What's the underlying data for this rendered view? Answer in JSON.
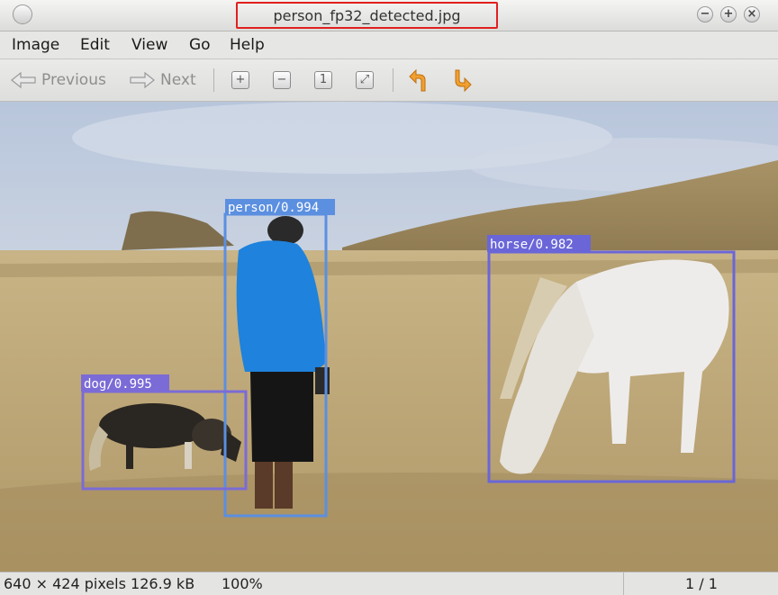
{
  "window": {
    "title": "person_fp32_detected.jpg",
    "buttons": {
      "minimize": "−",
      "maximize": "+",
      "close": "×"
    }
  },
  "menu": [
    "Image",
    "Edit",
    "View",
    "Go",
    "Help"
  ],
  "toolbar": {
    "previous_label": "Previous",
    "next_label": "Next",
    "icons": [
      "zoom-in-icon",
      "zoom-out-icon",
      "zoom-normal-icon",
      "zoom-fit-icon",
      "rotate-left-icon",
      "rotate-right-icon"
    ]
  },
  "detections": [
    {
      "label": "person/0.994",
      "color": "#5b8fe0"
    },
    {
      "label": "dog/0.995",
      "color": "#7b6bd6"
    },
    {
      "label": "horse/0.982",
      "color": "#6a66d8"
    }
  ],
  "status": {
    "info": "640 × 424 pixels  126.9 kB",
    "zoom": "100%",
    "page": "1 / 1"
  }
}
